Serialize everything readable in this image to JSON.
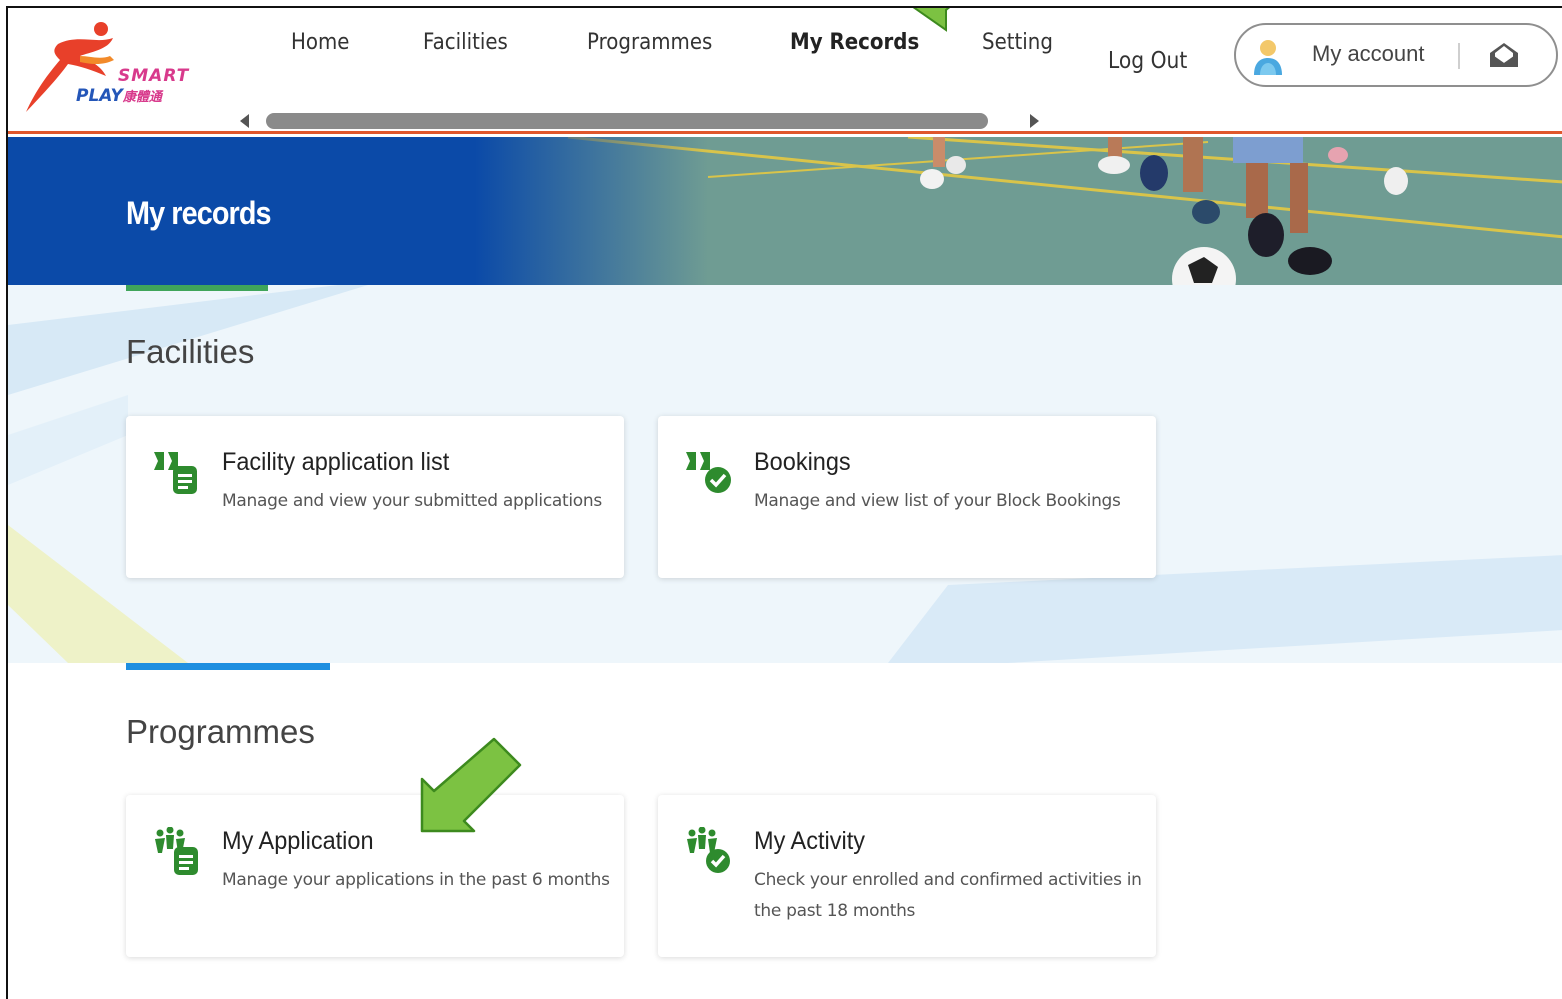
{
  "header": {
    "logo": {
      "word1": "SMART",
      "word2": "PLAY",
      "chinese": "康體通"
    },
    "nav": [
      {
        "label": "Home",
        "active": false
      },
      {
        "label": "Facilities",
        "active": false
      },
      {
        "label": "Programmes",
        "active": false
      },
      {
        "label": "My Records",
        "active": true
      },
      {
        "label": "Setting",
        "active": false
      }
    ],
    "logout_label": "Log Out",
    "account_label": "My account"
  },
  "banner": {
    "title": "My records"
  },
  "facilities": {
    "title": "Facilities",
    "cards": [
      {
        "title": "Facility application list",
        "description": "Manage and view your submitted applications",
        "icon": "facility-application-icon"
      },
      {
        "title": "Bookings",
        "description": "Manage and view list of your Block Bookings",
        "icon": "facility-booking-check-icon"
      }
    ]
  },
  "programmes": {
    "title": "Programmes",
    "cards": [
      {
        "title": "My Application",
        "description": "Manage your applications in the past 6 months",
        "icon": "programme-application-icon"
      },
      {
        "title": "My Activity",
        "description": "Check your enrolled and confirmed activities in the past 18 months",
        "icon": "programme-activity-check-icon"
      }
    ]
  },
  "colors": {
    "accent_orange": "#e0572c",
    "banner_blue": "#0b4aa8",
    "icon_green": "#2e8b2e",
    "accent_green": "#3fa55a",
    "accent_blue": "#1e8fe0",
    "arrow_green": "#7cc242"
  }
}
